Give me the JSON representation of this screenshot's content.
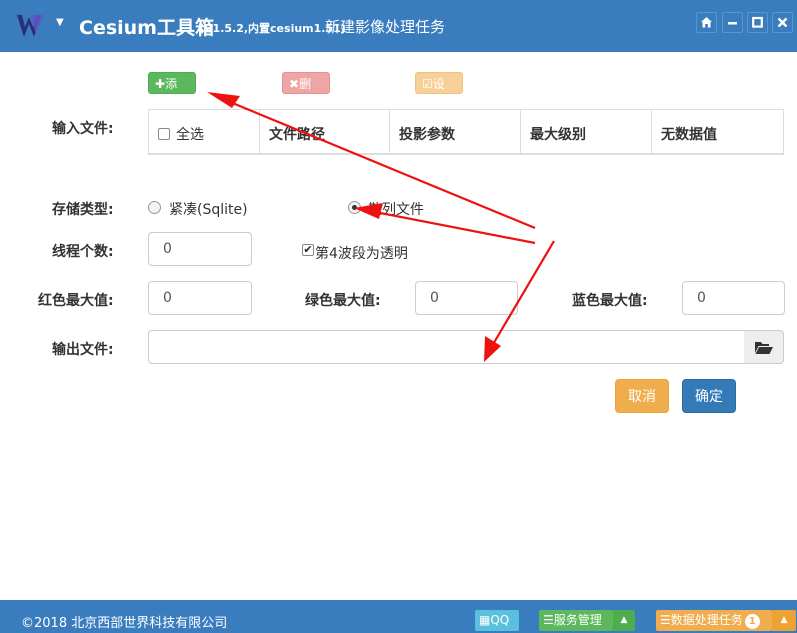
{
  "titlebar": {
    "logo_icon": "w-logo-icon",
    "app_name": "Cesium工具箱",
    "app_version": "(V1.5.2,内置cesium1.51)",
    "task_title": "新建影像处理任务",
    "buttons": {
      "home": "⌂",
      "minimize": "—",
      "maximize": "□",
      "close": "✕"
    }
  },
  "toolbar": {
    "add_label": "添加",
    "delete_label": "删除",
    "settings_label": "设置"
  },
  "form": {
    "input_files_label": "输入文件:",
    "table": {
      "select_all": "全选",
      "columns": [
        "文件路径",
        "投影参数",
        "最大级别",
        "无数据值"
      ]
    },
    "storage_type_label": "存储类型:",
    "storage_options": [
      "紧凑(Sqlite)",
      "散列文件"
    ],
    "storage_selected": "散列文件",
    "threads_label": "线程个数:",
    "threads_value": "0",
    "alpha_checkbox_label": "第4波段为透明",
    "alpha_checked": true,
    "red_max_label": "红色最大值:",
    "red_max_value": "0",
    "green_max_label": "绿色最大值:",
    "green_max_value": "0",
    "blue_max_label": "蓝色最大值:",
    "blue_max_value": "0",
    "output_file_label": "输出文件:",
    "output_file_value": "",
    "folder_icon": "folder-open-icon"
  },
  "dialog": {
    "cancel_label": "取消",
    "ok_label": "确定"
  },
  "footer": {
    "copyright": "©2018 北京西部世界科技有限公司",
    "qq_label": "QQ",
    "service_label": "服务管理",
    "tasks_label": "数据处理任务",
    "tasks_count": "1"
  },
  "colors": {
    "primary": "#3a7dbf",
    "success": "#5cb85c",
    "danger_muted": "#eea6a4",
    "warning_muted": "#f7cf99",
    "warning": "#f0ad4e",
    "info": "#5bc0de",
    "annotation_red": "#ee1111"
  }
}
